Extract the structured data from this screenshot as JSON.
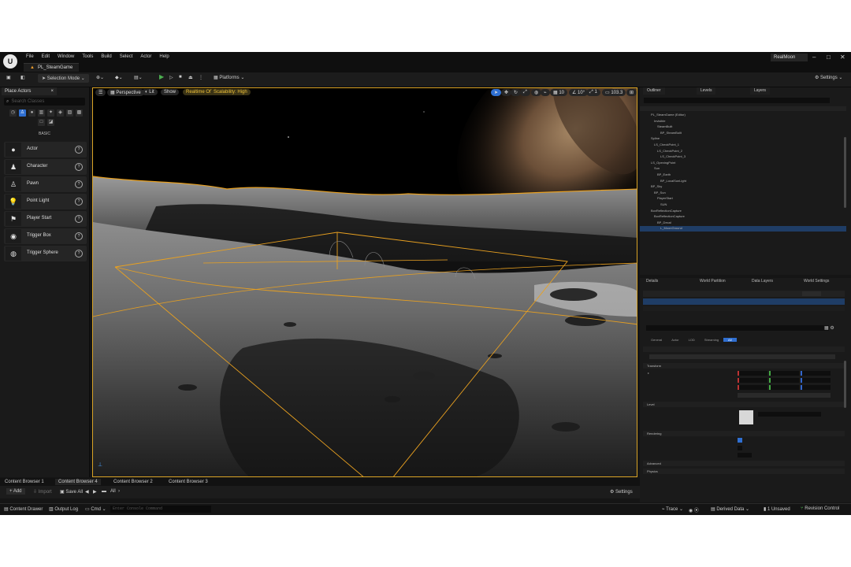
{
  "app": {
    "menu": [
      "File",
      "Edit",
      "Window",
      "Tools",
      "Build",
      "Select",
      "Actor",
      "Help"
    ],
    "level_tab": "PL_SteamGame",
    "project": "RealMoon"
  },
  "toolbar": {
    "selection_mode": "Selection Mode",
    "platforms": "Platforms",
    "settings": "Settings"
  },
  "place_actors": {
    "tab": "Place Actors",
    "search_placeholder": "Search Classes",
    "category": "BASIC",
    "items": [
      {
        "label": "Actor",
        "icon": "actor-sphere-icon"
      },
      {
        "label": "Character",
        "icon": "character-icon"
      },
      {
        "label": "Pawn",
        "icon": "pawn-icon"
      },
      {
        "label": "Point Light",
        "icon": "point-light-icon"
      },
      {
        "label": "Player Start",
        "icon": "player-start-icon"
      },
      {
        "label": "Trigger Box",
        "icon": "trigger-box-icon"
      },
      {
        "label": "Trigger Sphere",
        "icon": "trigger-sphere-icon"
      }
    ]
  },
  "viewport": {
    "perspective": "Perspective",
    "lit": "Lit",
    "show": "Show",
    "realtime": "Realtime Off",
    "scalability": "Scalability: High",
    "grid_snap": "10",
    "rotation_snap": "10°",
    "scale_snap": "1",
    "camera_speed": "103.3"
  },
  "content_browser": {
    "tabs": [
      "Content Browser 1",
      "Content Browser 4",
      "Content Browser 2",
      "Content Browser 3"
    ],
    "add": "Add",
    "import": "Import",
    "save_all": "Save All",
    "path": "All",
    "settings": "Settings"
  },
  "statusbar": {
    "content_drawer": "Content Drawer",
    "output_log": "Output Log",
    "cmd": "Cmd",
    "console_placeholder": "Enter Console Command",
    "trace": "Trace",
    "derived_data": "Derived Data",
    "unsaved": "1 Unsaved",
    "revision_control": "Revision Control"
  },
  "outliner": {
    "tabs": [
      "Outliner",
      "Levels",
      "Layers"
    ],
    "rows": [
      {
        "c1": "PL_SteamGame (Editor)",
        "c2": "",
        "c3": ""
      },
      {
        "c1": "Invisible",
        "c2": "",
        "c3": ""
      },
      {
        "c1": "SteamBuilt",
        "c2": "",
        "c3": ""
      },
      {
        "c1": "BP_SteamBuilt",
        "c2": "",
        "c3": ""
      },
      {
        "c1": "Spline",
        "c2": "",
        "c3": ""
      },
      {
        "c1": "LS_CheckPoint_1",
        "c2": "",
        "c3": ""
      },
      {
        "c1": "LS_CheckPoint_2",
        "c2": "",
        "c3": ""
      },
      {
        "c1": "LS_CheckPoint_3",
        "c2": "",
        "c3": ""
      },
      {
        "c1": "LS_OpeningPoint",
        "c2": "",
        "c3": ""
      },
      {
        "c1": "Sun",
        "c2": "",
        "c3": ""
      },
      {
        "c1": "BP_Earth",
        "c2": "",
        "c3": ""
      },
      {
        "c1": "BP_LocalSunLight",
        "c2": "",
        "c3": ""
      },
      {
        "c1": "BP_Sky",
        "c2": "",
        "c3": ""
      },
      {
        "c1": "BP_Sun",
        "c2": "",
        "c3": ""
      },
      {
        "c1": "PlayerStart",
        "c2": "",
        "c3": ""
      },
      {
        "c1": "SUN",
        "c2": "",
        "c3": ""
      },
      {
        "c1": "BoxReflectionCapture",
        "c2": "",
        "c3": ""
      },
      {
        "c1": "BoxReflectionCapture",
        "c2": "",
        "c3": ""
      },
      {
        "c1": "BP_Decal",
        "c2": "",
        "c3": ""
      },
      {
        "c1": "L_MoonGround",
        "c2": "",
        "c3": "",
        "selected": true
      },
      {
        "c1": "",
        "c2": "",
        "c3": ""
      },
      {
        "c1": "",
        "c2": "",
        "c3": ""
      }
    ]
  },
  "details": {
    "tabs": [
      "Details",
      "World Partition",
      "Data Layers",
      "World Settings"
    ],
    "sections": [
      "Transform",
      "Level",
      "Rendering",
      "Advanced",
      "Physics"
    ],
    "filter_tabs": [
      "General",
      "Actor",
      "LOD",
      "Streaming",
      "All"
    ]
  },
  "colors": {
    "selection_orange": "#e8a020",
    "accent_blue": "#2f6fd1",
    "play_green": "#4caf50"
  }
}
